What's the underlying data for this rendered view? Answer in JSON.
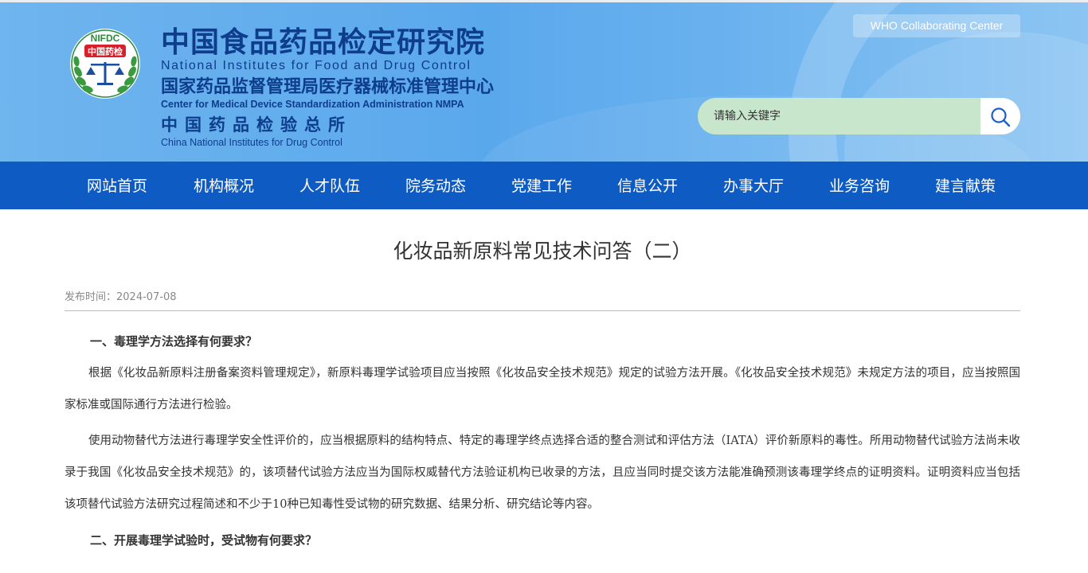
{
  "header": {
    "emblem": {
      "text_top": "NIFDC",
      "text_badge": "中国药检"
    },
    "titles": {
      "cn_1": "中国食品药品检定研究院",
      "en_1": "National Institutes for Food and Drug Control",
      "cn_2": "国家药品监督管理局医疗器械标准管理中心",
      "en_2": "Center for Medical Device Standardization Administration NMPA",
      "cn_3": "中国药品检验总所",
      "en_3": "China National Institutes for Drug Control"
    },
    "who_button": "WHO Collaborating Center",
    "search": {
      "placeholder": "请输入关键字",
      "value": ""
    },
    "icons": {
      "search": "search-icon"
    },
    "colors": {
      "brand_blue": "#0e3d8c",
      "nav_blue": "#0f5bc4",
      "search_bg": "#c8e6cc"
    }
  },
  "nav": {
    "items": [
      "网站首页",
      "机构概况",
      "人才队伍",
      "院务动态",
      "党建工作",
      "信息公开",
      "办事大厅",
      "业务咨询",
      "建言献策"
    ]
  },
  "article": {
    "title": "化妆品新原料常见技术问答（二）",
    "meta_label": "发布时间：",
    "meta_date": "2024-07-08",
    "heading_1": "一、毒理学方法选择有何要求？",
    "para_1": "根据《化妆品新原料注册备案资料管理规定》，新原料毒理学试验项目应当按照《化妆品安全技术规范》规定的试验方法开展。《化妆品安全技术规范》未规定方法的项目，应当按照国家标准或国际通行方法进行检验。",
    "para_2": "使用动物替代方法进行毒理学安全性评价的，应当根据原料的结构特点、特定的毒理学终点选择合适的整合测试和评估方法（IATA）评价新原料的毒性。所用动物替代试验方法尚未收录于我国《化妆品安全技术规范》的，该项替代试验方法应当为国际权威替代方法验证机构已收录的方法，且应当同时提交该方法能准确预测该毒理学终点的证明资料。证明资料应当包括该项替代试验方法研究过程简述和不少于10种已知毒性受试物的研究数据、结果分析、研究结论等内容。",
    "heading_2": "二、开展毒理学试验时，受试物有何要求？"
  }
}
